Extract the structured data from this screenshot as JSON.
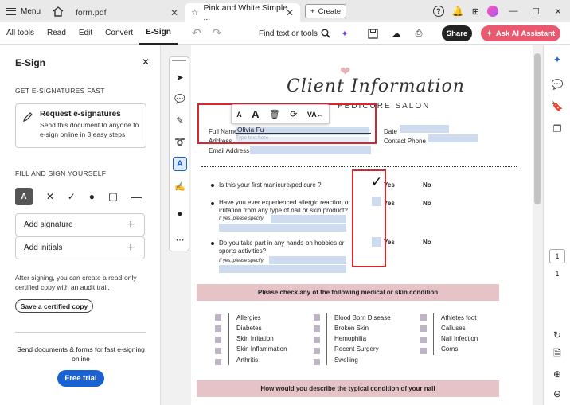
{
  "browser": {
    "menu_label": "Menu",
    "tabs": [
      {
        "title": "form.pdf",
        "active": false
      },
      {
        "title": "Pink and White Simple ...",
        "active": true
      }
    ],
    "create_label": "Create"
  },
  "toolbar": {
    "nav": [
      "All tools",
      "Read",
      "Edit",
      "Convert",
      "E-Sign"
    ],
    "active_nav": "E-Sign",
    "find_label": "Find text or tools",
    "share_label": "Share",
    "ai_label": "Ask AI Assistant"
  },
  "left_panel": {
    "title": "E-Sign",
    "section_fast": "GET E-SIGNATURES FAST",
    "request_title": "Request e-signatures",
    "request_desc": "Send this document to anyone to e-sign online in 3 easy steps",
    "section_self": "FILL AND SIGN YOURSELF",
    "add_signature": "Add signature",
    "add_initials": "Add initials",
    "cert_text": "After signing, you can create a read-only certified copy with an audit trail.",
    "cert_button": "Save a certified copy",
    "promo_text": "Send documents & forms for fast e-signing online",
    "trial_button": "Free trial"
  },
  "document": {
    "title_script": "Client Information",
    "salon": "PEDICURE SALON",
    "labels": {
      "full_name": "Full Name",
      "address": "Address",
      "email": "Email Address",
      "date": "Date",
      "contact": "Contact Phone"
    },
    "full_name_value": "Olivia Fu",
    "placeholder": "Type text here",
    "questions": [
      {
        "text": "Is this your first manicure/pedicure ?",
        "yes": "Yes",
        "no": "No"
      },
      {
        "text": "Have you ever experienced allergic reaction or irritation from any type of nail or skin product?",
        "note": "If yes, please specify",
        "yes": "Yes",
        "no": "No"
      },
      {
        "text": "Do you take part in any hands-on hobbies or sports activities?",
        "note": "If yes, please specify",
        "yes": "Yes",
        "no": "No"
      }
    ],
    "conditions_header": "Please check any of the following medical or skin condition",
    "conditions": [
      [
        "Allergies",
        "Diabetes",
        "Skin Irritation",
        "Skin Inflammation",
        "Arthritis"
      ],
      [
        "Blood Born Disease",
        "Broken Skin",
        "Hemophilia",
        "Recent Surgery",
        "Swelling"
      ],
      [
        "Athletes foot",
        "Calluses",
        "Nail Infection",
        "Corns"
      ]
    ],
    "nail_header": "How would you describe the typical condition of your nail"
  },
  "pager": {
    "current": "1",
    "total": "1"
  }
}
